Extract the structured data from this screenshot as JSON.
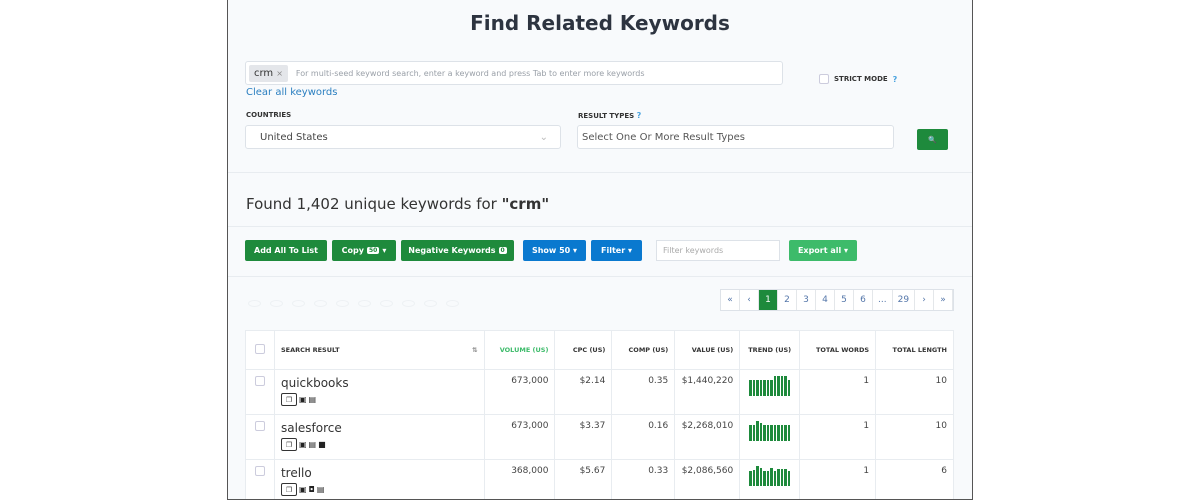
{
  "title": "Find Related Keywords",
  "search": {
    "chip": "crm",
    "chip_remove": "×",
    "placeholder": "For multi-seed keyword search, enter a keyword and press Tab to enter more keywords",
    "clear": "Clear all keywords",
    "strict": "STRICT MODE",
    "help": "?"
  },
  "countries": {
    "label": "COUNTRIES",
    "value": "United States",
    "chevron": "⌄"
  },
  "result_types": {
    "label": "RESULT TYPES",
    "placeholder": "Select One Or More Result Types"
  },
  "search_icon": "🔍",
  "found": {
    "prefix": "Found 1,402 unique keywords for ",
    "term": "\"crm\""
  },
  "toolbar": {
    "add": "Add All To List",
    "copy": "Copy",
    "copy_badge": "50",
    "neg": "Negative Keywords",
    "neg_badge": "0",
    "show": "Show 50 ▾",
    "filter": "Filter ▾",
    "filter_ph": "Filter keywords",
    "export": "Export all ▾"
  },
  "pager": [
    "«",
    "‹",
    "1",
    "2",
    "3",
    "4",
    "5",
    "6",
    "...",
    "29",
    "›",
    "»"
  ],
  "columns": {
    "search": "SEARCH RESULT",
    "volume": "VOLUME (US)",
    "cpc": "CPC (US)",
    "comp": "COMP (US)",
    "value": "VALUE (US)",
    "trend": "TREND (US)",
    "words": "TOTAL WORDS",
    "length": "TOTAL LENGTH",
    "sort": "⇅"
  },
  "rows": [
    {
      "keyword": "quickbooks",
      "volume": "673,000",
      "cpc": "$2.14",
      "comp": "0.35",
      "value": "$1,440,220",
      "words": "1",
      "length": "10",
      "icons": [
        "▣",
        "▤"
      ],
      "trend": [
        0.8,
        0.8,
        0.8,
        0.8,
        0.8,
        0.8,
        0.8,
        1,
        1,
        1,
        1,
        0.8
      ]
    },
    {
      "keyword": "salesforce",
      "volume": "673,000",
      "cpc": "$3.37",
      "comp": "0.16",
      "value": "$2,268,010",
      "words": "1",
      "length": "10",
      "icons": [
        "▣",
        "▤",
        "■"
      ],
      "trend": [
        0.8,
        0.8,
        1,
        0.9,
        0.8,
        0.8,
        0.8,
        0.8,
        0.8,
        0.8,
        0.8,
        0.8
      ]
    },
    {
      "keyword": "trello",
      "volume": "368,000",
      "cpc": "$5.67",
      "comp": "0.33",
      "value": "$2,086,560",
      "words": "1",
      "length": "6",
      "icons": [
        "▣",
        "◘",
        "▤"
      ],
      "trend": [
        0.75,
        0.8,
        1,
        0.9,
        0.75,
        0.75,
        0.9,
        0.75,
        0.85,
        0.85,
        0.85,
        0.75
      ]
    }
  ]
}
